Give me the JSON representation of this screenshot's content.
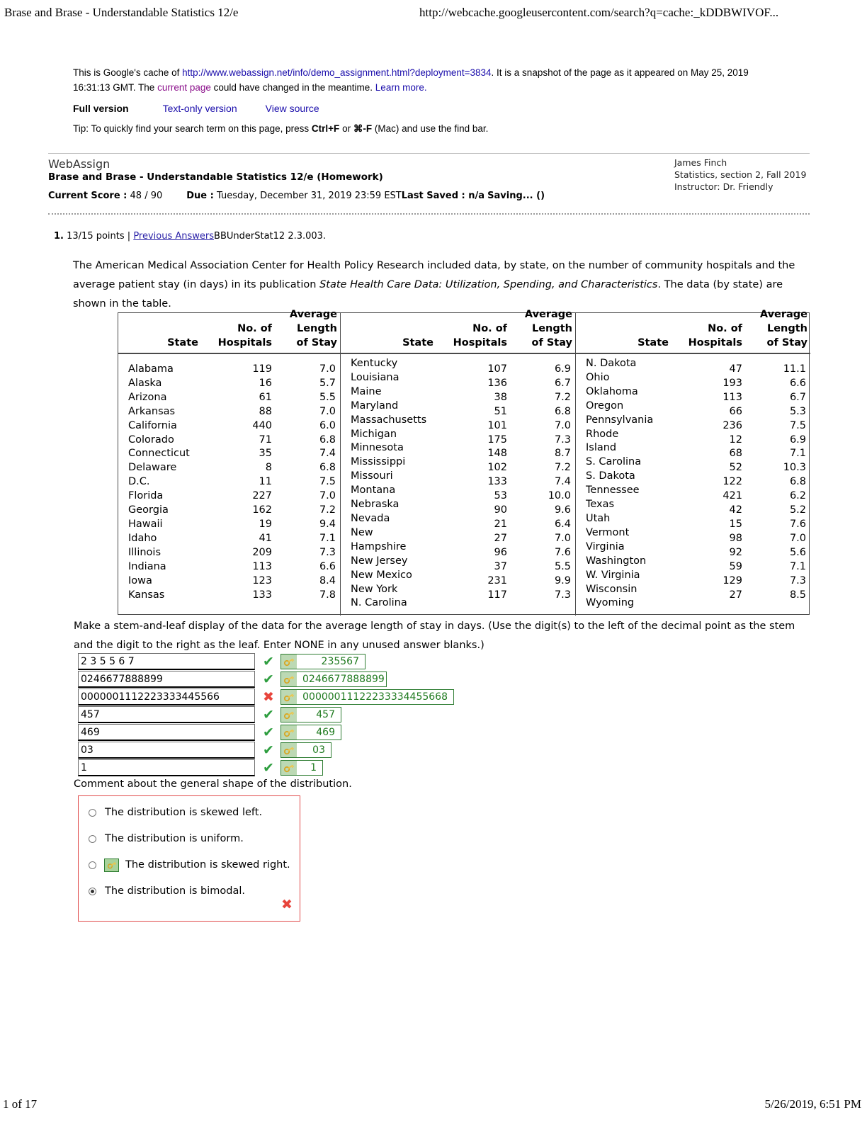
{
  "browser": {
    "header_left": "Brase and Brase - Understandable Statistics 12/e",
    "header_right": "http://webcache.googleusercontent.com/search?q=cache:_kDDBWIVOF...",
    "footer_left": "1 of 17",
    "footer_right": "5/26/2019, 6:51 PM"
  },
  "cache_notice": {
    "prefix": "This is Google's cache of ",
    "cached_url": "http://www.webassign.net/info/demo_assignment.html?deployment=3834",
    "middle": ". It is a snapshot of the page as it appeared on May 25, 2019 16:31:13 GMT. The ",
    "current_page_link": "current page",
    "suffix": " could have changed in the meantime. ",
    "learn_more_link": "Learn more.",
    "full_version": "Full version",
    "text_only_version": "Text-only version",
    "view_source": "View source",
    "tip_prefix": "Tip: To quickly find your search term on this page, press ",
    "tip_key1": "Ctrl+F",
    "tip_or": " or ",
    "tip_key2": "⌘-F",
    "tip_suffix": " (Mac) and use the find bar."
  },
  "webassign": {
    "brand": "WebAssign",
    "course_title": "Brase and Brase - Understandable Statistics 12/e (Homework)",
    "score_label": "Current Score :",
    "score_value": "48 / 90",
    "due_label": "Due :",
    "due_value": "Tuesday, December 31, 2019 23:59 EST",
    "last_saved": "Last Saved : n/a",
    "saving": "Saving... ()",
    "student_name": "James Finch",
    "section": "Statistics, section 2, Fall 2019",
    "instructor": "Instructor: Dr. Friendly"
  },
  "question": {
    "number": "1.",
    "points": "13/15 points |",
    "previous_answers_link": "Previous Answers",
    "code": "BBUnderStat12 2.3.003.",
    "body_1": "The American Medical Association Center for Health Policy Research included data, by state, on the number of community hospitals and the average patient stay (in days) in its publication ",
    "body_italic": "State Health Care Data: Utilization, Spending, and Characteristics",
    "body_2": ". The data (by state) are shown in the table."
  },
  "table": {
    "headers": {
      "state": "State",
      "hospitals_l1": "No. of",
      "hospitals_l2": "Hospitals",
      "stay_l1": "Average",
      "stay_l2": "Length",
      "stay_l3": "of Stay"
    },
    "group1": {
      "states": [
        "Alabama",
        "Alaska",
        "Arizona",
        "Arkansas",
        "California",
        "Colorado",
        "Connecticut",
        "Delaware",
        "D.C.",
        "Florida",
        "Georgia",
        "Hawaii",
        "Idaho",
        "Illinois",
        "Indiana",
        "Iowa",
        "Kansas"
      ],
      "hospitals": [
        "119",
        "16",
        "61",
        "88",
        "440",
        "71",
        "35",
        "8",
        "11",
        "227",
        "162",
        "19",
        "41",
        "209",
        "113",
        "123",
        "133"
      ],
      "stay": [
        "7.0",
        "5.7",
        "5.5",
        "7.0",
        "6.0",
        "6.8",
        "7.4",
        "6.8",
        "7.5",
        "7.0",
        "7.2",
        "9.4",
        "7.1",
        "7.3",
        "6.6",
        "8.4",
        "7.8"
      ]
    },
    "group2": {
      "states": [
        "Kentucky",
        "Louisiana",
        "Maine",
        "Maryland",
        "Massachusetts",
        "Michigan",
        "Minnesota",
        "Mississippi",
        "Missouri",
        "Montana",
        "Nebraska",
        "Nevada",
        "New",
        "Hampshire",
        "New Jersey",
        "New Mexico",
        "New York",
        "N. Carolina"
      ],
      "hospitals": [
        "107",
        "136",
        "38",
        "51",
        "101",
        "175",
        "148",
        "102",
        "133",
        "53",
        "90",
        "21",
        "27",
        "96",
        "37",
        "231",
        "117"
      ],
      "stay": [
        "6.9",
        "6.7",
        "7.2",
        "6.8",
        "7.0",
        "7.3",
        "8.7",
        "7.2",
        "7.4",
        "10.0",
        "9.6",
        "6.4",
        "7.0",
        "7.6",
        "5.5",
        "9.9",
        "7.3"
      ]
    },
    "group3": {
      "states": [
        "N. Dakota",
        "Ohio",
        "Oklahoma",
        "Oregon",
        "Pennsylvania",
        "Rhode",
        "Island",
        "S. Carolina",
        "S. Dakota",
        "Tennessee",
        "Texas",
        "Utah",
        "Vermont",
        "Virginia",
        "Washington",
        "W. Virginia",
        "Wisconsin",
        "Wyoming"
      ],
      "hospitals": [
        "47",
        "193",
        "113",
        "66",
        "236",
        "12",
        "68",
        "52",
        "122",
        "421",
        "42",
        "15",
        "98",
        "92",
        "59",
        "129",
        "27"
      ],
      "stay": [
        "11.1",
        "6.6",
        "6.7",
        "5.3",
        "7.5",
        "6.9",
        "7.1",
        "10.3",
        "6.8",
        "6.2",
        "5.2",
        "7.6",
        "7.0",
        "5.6",
        "7.1",
        "7.3",
        "8.5"
      ]
    }
  },
  "stem_leaf": {
    "prompt": "Make a stem-and-leaf display of the data for the average length of stay in days. (Use the digit(s) to the left of the decimal point as the stem and the digit to the right as the leaf. Enter NONE in any unused answer blanks.)",
    "rows": [
      {
        "value": "2 3 5 5 6 7",
        "status": "correct",
        "mark": "✔",
        "key": "235567"
      },
      {
        "value": "0246677888899",
        "status": "correct",
        "mark": "✔",
        "key": "0246677888899"
      },
      {
        "value": "0000001112223333445566",
        "status": "incorrect",
        "mark": "✖",
        "key": "00000011122233334455668"
      },
      {
        "value": "457",
        "status": "correct",
        "mark": "✔",
        "key": "457"
      },
      {
        "value": "469",
        "status": "correct",
        "mark": "✔",
        "key": "469"
      },
      {
        "value": "03",
        "status": "correct",
        "mark": "✔",
        "key": "03"
      },
      {
        "value": "1",
        "status": "correct",
        "mark": "✔",
        "key": "1"
      }
    ]
  },
  "multiple_choice": {
    "prompt": "Comment about the general shape of the distribution.",
    "options": [
      {
        "label": "The distribution is skewed left.",
        "selected": false,
        "has_key": false
      },
      {
        "label": "The distribution is uniform.",
        "selected": false,
        "has_key": false
      },
      {
        "label": "The distribution is skewed right.",
        "selected": false,
        "has_key": true
      },
      {
        "label": "The distribution is bimodal.",
        "selected": true,
        "has_key": false
      }
    ],
    "mark": "✖"
  },
  "colors": {
    "link_blue": "#1a0dab",
    "link_purple": "#8b0f8b",
    "correct_green": "#2e9e3f",
    "incorrect_red": "#e8453c",
    "key_green_text": "#1f7a1f",
    "key_border": "#2e7d32",
    "mc_box_border": "#e04a4a"
  }
}
